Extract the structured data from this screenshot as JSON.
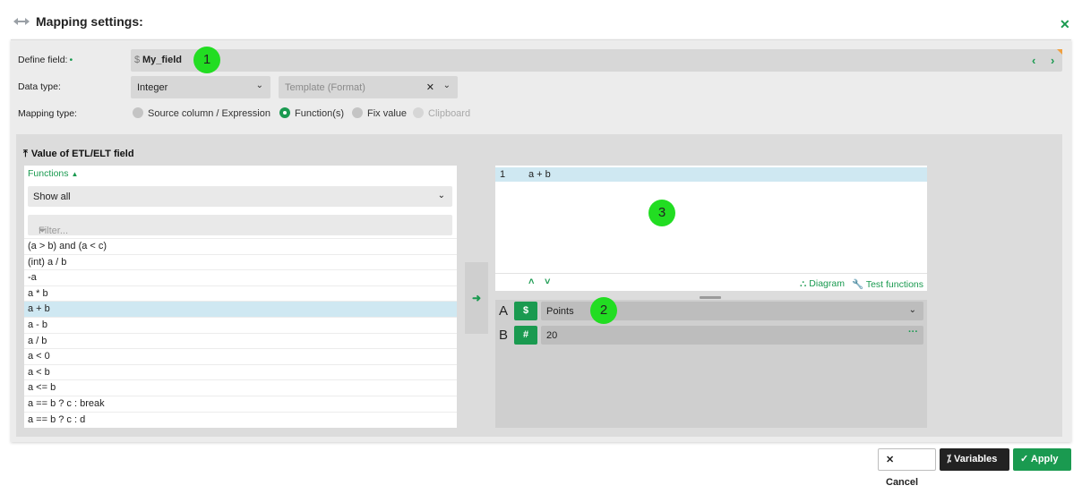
{
  "dialog": {
    "title": "Mapping settings:",
    "close_icon": "close-icon"
  },
  "define_field": {
    "label": "Define field:",
    "required_mark": "•",
    "prefix": "$",
    "value": "My_field"
  },
  "data_type": {
    "label": "Data type:",
    "selected": "Integer",
    "template_placeholder": "Template (Format)",
    "clear_glyph": "✕"
  },
  "mapping_type": {
    "label": "Mapping type:",
    "options": [
      "Source column / Expression",
      "Function(s)",
      "Fix value",
      "Clipboard"
    ],
    "selected": "Function(s)"
  },
  "etl": {
    "title": "Value of ETL/ELT field",
    "functions_header": "Functions",
    "filter_selected": "Show all",
    "filter_placeholder": "Filter...",
    "functions": [
      "(a > b) and (a < c)",
      "(int) a / b",
      "-a",
      "a * b",
      "a + b",
      "a - b",
      "a / b",
      "a < 0",
      "a < b",
      "a <= b",
      "a == b ? c : break",
      "a == b ? c : d"
    ],
    "selected_function": "a + b"
  },
  "editor": {
    "line_number": "1",
    "code": "a + b",
    "diagram_label": "Diagram",
    "test_label": "Test functions"
  },
  "params": [
    {
      "letter": "A",
      "type": "$",
      "value": "Points"
    },
    {
      "letter": "B",
      "type": "#",
      "value": "20"
    }
  ],
  "badges": [
    "1",
    "2",
    "3"
  ],
  "footer": {
    "cancel": "Cancel",
    "variables": "Variables",
    "apply": "Apply"
  }
}
